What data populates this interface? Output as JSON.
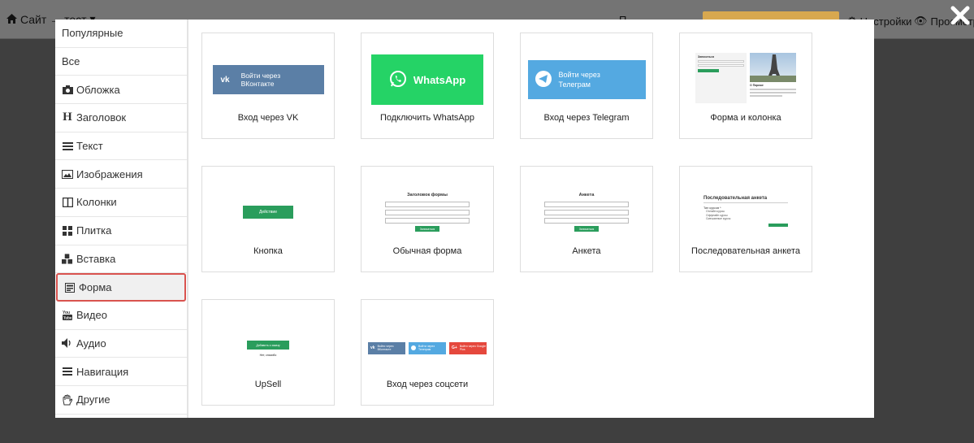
{
  "topbar": {
    "site_label": "Сайт → тест",
    "middle_label": "П",
    "settings_label": "Настройки",
    "preview_label": "Просмотр"
  },
  "sidebar": {
    "items": [
      {
        "label": "Популярные",
        "icon": "none"
      },
      {
        "label": "Все",
        "icon": "none"
      },
      {
        "label": "Обложка",
        "icon": "camera-icon"
      },
      {
        "label": "Заголовок",
        "icon": "header-icon"
      },
      {
        "label": "Текст",
        "icon": "align-justify-icon"
      },
      {
        "label": "Изображения",
        "icon": "image-icon"
      },
      {
        "label": "Колонки",
        "icon": "columns-icon"
      },
      {
        "label": "Плитка",
        "icon": "grid-icon"
      },
      {
        "label": "Вставка",
        "icon": "cubes-icon"
      },
      {
        "label": "Форма",
        "icon": "form-icon",
        "active": true
      },
      {
        "label": "Видео",
        "icon": "youtube-icon"
      },
      {
        "label": "Аудио",
        "icon": "volume-icon"
      },
      {
        "label": "Навигация",
        "icon": "bars-icon"
      },
      {
        "label": "Другие",
        "icon": "hand-icon"
      }
    ]
  },
  "cards": [
    {
      "label": "Вход через VK",
      "thumb": {
        "text1": "Войти через",
        "text2": "ВКонтакте"
      }
    },
    {
      "label": "Подключить WhatsApp",
      "thumb": {
        "text": "WhatsApp"
      }
    },
    {
      "label": "Вход через Telegram",
      "thumb": {
        "text1": "Войти через",
        "text2": "Телеграм"
      }
    },
    {
      "label": "Форма и колонка",
      "thumb": {
        "title": "Записаться",
        "caption": "О Париже"
      }
    },
    {
      "label": "Кнопка",
      "thumb": {
        "text": "Действие"
      }
    },
    {
      "label": "Обычная форма",
      "thumb": {
        "title": "Заголовок формы",
        "btn": "Записаться"
      }
    },
    {
      "label": "Анкета",
      "thumb": {
        "title": "Анкета",
        "btn": "Записаться"
      }
    },
    {
      "label": "Последовательная анкета",
      "thumb": {
        "title": "Последовательная анкета",
        "question": "Тип курсов *",
        "options": [
          "Онлайн курсы",
          "Оффлайн курсы",
          "Смешанные курсы"
        ]
      }
    },
    {
      "label": "UpSell",
      "thumb": {
        "btn": "Добавить к заказу",
        "note": "Нет, спасибо"
      }
    },
    {
      "label": "Вход через соцсети",
      "thumb": {
        "vk": "Войти через ВКонтакте",
        "tg": "Войти через Телеграм",
        "google": "Войти через Google Plus"
      }
    }
  ],
  "colors": {
    "vk": "#5b7fa6",
    "whatsapp": "#25d366",
    "telegram": "#54a9e1",
    "green_button": "#2a9d5c",
    "active_border": "#d9534f"
  }
}
